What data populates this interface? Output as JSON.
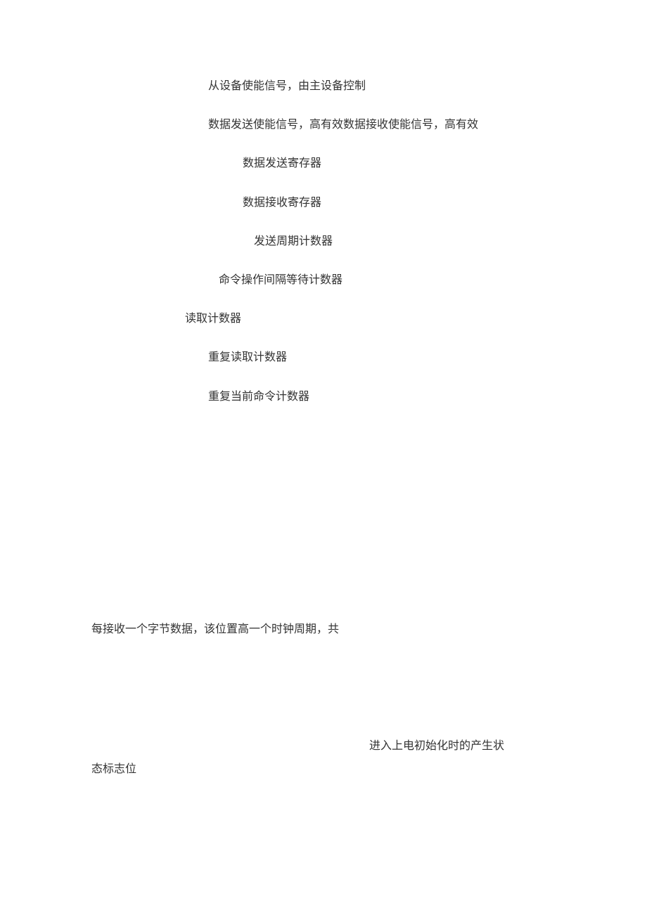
{
  "lines": {
    "l1": "从设备使能信号，由主设备控制",
    "l2": "数据发送使能信号，高有效数据接收使能信号，高有效",
    "l3": "数据发送寄存器",
    "l4": "数据接收寄存器",
    "l5": "发送周期计数器",
    "l6": "命令操作间隔等待计数器",
    "l7": "读取计数器",
    "l8": "重复读取计数器",
    "l9": "重复当前命令计数器",
    "l10": "每接收一个字节数据，该位置高一个时钟周期，共",
    "l11a": "进入上电初始化时的产生状",
    "l11b": "态标志位"
  }
}
